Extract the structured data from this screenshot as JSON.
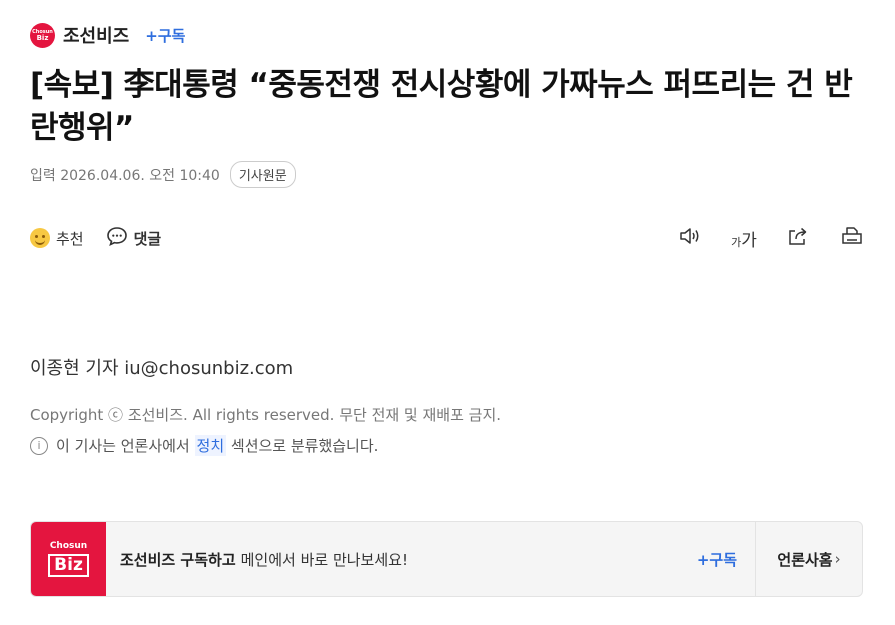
{
  "press": {
    "logo_top": "Chosun",
    "logo_bottom": "Biz",
    "name": "조선비즈",
    "subscribe_label": "+구독"
  },
  "article": {
    "headline": "[속보] 李대통령 “중동전쟁 전시상황에 가짜뉴스 퍼뜨리는 건 반란행위”",
    "date_label": "입력 2026.04.06. 오전 10:40",
    "original_button": "기사원문",
    "byline": "이종현 기자 iu@chosunbiz.com",
    "copyright": "Copyright ⓒ 조선비즈. All rights reserved. 무단 전재 및 재배포 금지.",
    "category_note_before": "이 기사는 언론사에서 ",
    "category_link": "정치",
    "category_note_after": " 섹션으로 분류했습니다."
  },
  "actions": {
    "recommend_label": "추천",
    "comment_label": "댓글",
    "fontsize_small": "가",
    "fontsize_large": "가"
  },
  "icons": {
    "recommend": "smile-icon",
    "comment": "speech-bubble-icon",
    "tts": "speaker-icon",
    "fontsize": "font-size-icon",
    "share": "share-icon",
    "print": "print-icon",
    "info": "info-icon",
    "chevron": "chevron-right-icon"
  },
  "banner": {
    "logo_top": "Chosun",
    "logo_bottom": "Biz",
    "bold_text": "조선비즈 구독하고",
    "text": "메인에서 바로 만나보세요!",
    "subscribe_label": "+구독",
    "press_home_label": "언론사홈",
    "chevron": "›"
  },
  "colors": {
    "brand_red": "#e4153f",
    "accent_blue": "#2f6ede"
  },
  "info_glyph": "i"
}
